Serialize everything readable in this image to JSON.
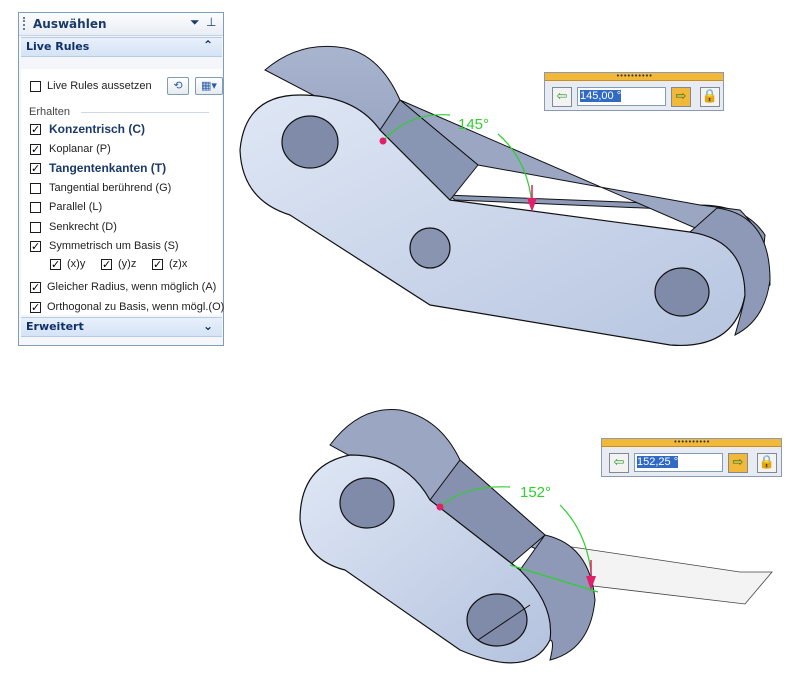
{
  "panel": {
    "title": "Auswählen",
    "title_icon_left": "chevron-down-icon",
    "title_icon_right": "pin-icon",
    "live_rules_header": "Live Rules",
    "suspend_label": "Live Rules aussetzen",
    "keep_label": "Erhalten",
    "rules": [
      {
        "label": "Konzentrisch (C)",
        "checked": true,
        "bold": true
      },
      {
        "label": "Koplanar (P)",
        "checked": true,
        "bold": false
      },
      {
        "label": "Tangentenkanten (T)",
        "checked": true,
        "bold": true
      },
      {
        "label": "Tangential berührend (G)",
        "checked": false,
        "bold": false
      },
      {
        "label": "Parallel (L)",
        "checked": false,
        "bold": false
      },
      {
        "label": "Senkrecht (D)",
        "checked": false,
        "bold": false
      },
      {
        "label": "Symmetrisch um Basis (S)",
        "checked": true,
        "bold": false
      }
    ],
    "axes": [
      "(x)y",
      "(y)z",
      "(z)x"
    ],
    "equal_radius": "Gleicher Radius, wenn möglich (A)",
    "orthogonal": "Orthogonal zu Basis, wenn mögl.(O)",
    "advanced_header": "Erweitert"
  },
  "dialog1": {
    "value": "145,00 °",
    "grip": "••••••••••"
  },
  "dialog2": {
    "value": "152,25 °",
    "grip": "••••••••••"
  },
  "angle1": "145°",
  "angle2": "152°",
  "colors": {
    "part_face": "#c8d5ea",
    "part_side": "#8c99b8",
    "angle_arc": "#2fcf2f",
    "arrow": "#e0206a"
  }
}
